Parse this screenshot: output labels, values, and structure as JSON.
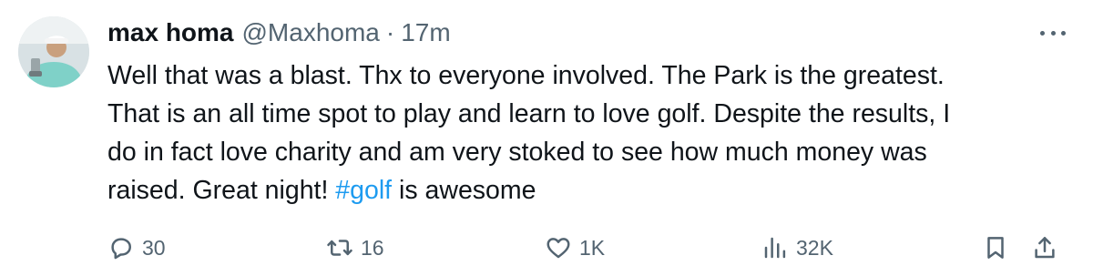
{
  "tweet": {
    "author_name": "max homa",
    "author_handle": "@Maxhoma",
    "separator": "·",
    "time": "17m",
    "text_lines": [
      "Well that was a blast. Thx to everyone involved. The Park is the greatest.",
      "That is an all time spot to play and learn to love golf. Despite the results, I",
      "do in fact love charity and am very stoked to see how much money was"
    ],
    "text_last_prefix": "raised. Great night! ",
    "hashtag": "#golf",
    "text_last_suffix": " is awesome",
    "more_icon": "more-horizontal-icon"
  },
  "actions": {
    "reply_count": "30",
    "retweet_count": "16",
    "like_count": "1K",
    "views_count": "32K",
    "reply_icon": "reply-icon",
    "retweet_icon": "retweet-icon",
    "like_icon": "heart-icon",
    "views_icon": "views-chart-icon",
    "bookmark_icon": "bookmark-icon",
    "share_icon": "share-icon"
  },
  "colors": {
    "text": "#0f1419",
    "secondary": "#536471",
    "link": "#1d9bf0",
    "background": "#ffffff"
  }
}
